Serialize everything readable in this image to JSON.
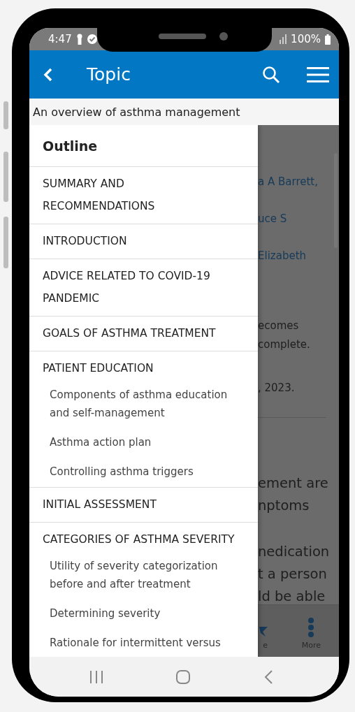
{
  "status_bar": {
    "time": "4:47",
    "battery": "100%"
  },
  "app_bar": {
    "title": "Topic"
  },
  "subtitle": "An overview of asthma management",
  "article": [
    {
      "kind": "link",
      "text": "a A Barrett,"
    },
    {
      "kind": "link",
      "text": "uce S"
    },
    {
      "kind": "link",
      "text": "Elizabeth"
    },
    {
      "kind": "text",
      "text": "ecomes"
    },
    {
      "kind": "text",
      "text": "complete."
    },
    {
      "kind": "text",
      "text": ", 2023."
    },
    {
      "kind": "body",
      "text": "ement are"
    },
    {
      "kind": "body",
      "text": "nptoms"
    },
    {
      "kind": "body",
      "text": "nedication"
    },
    {
      "kind": "body",
      "text": "t a person"
    },
    {
      "kind": "body",
      "text": "ld be able"
    }
  ],
  "tab_bar": [
    {
      "kind": "star",
      "label": "e"
    },
    {
      "kind": "more",
      "label": "More"
    }
  ],
  "outline": {
    "title": "Outline",
    "sections": [
      {
        "label": "SUMMARY AND RECOMMENDATIONS"
      },
      {
        "label": "INTRODUCTION"
      },
      {
        "label": "ADVICE RELATED TO COVID-19 PANDEMIC"
      },
      {
        "label": "GOALS OF ASTHMA TREATMENT"
      },
      {
        "label": "PATIENT EDUCATION",
        "children": [
          {
            "label": "Components of asthma education and self-management"
          },
          {
            "label": "Asthma action plan"
          },
          {
            "label": "Controlling asthma triggers"
          }
        ]
      },
      {
        "label": "INITIAL ASSESSMENT"
      },
      {
        "label": "CATEGORIES OF ASTHMA SEVERITY",
        "children": [
          {
            "label": "Utility of severity categorization before and after treatment"
          },
          {
            "label": "Determining severity"
          },
          {
            "label": "Rationale for intermittent versus"
          }
        ]
      }
    ]
  }
}
